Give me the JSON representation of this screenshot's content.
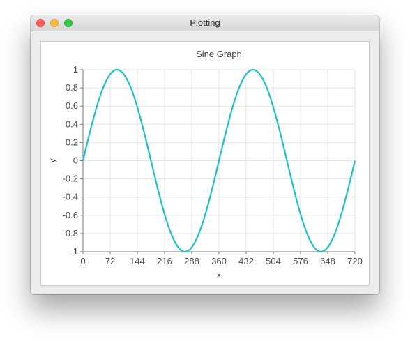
{
  "window": {
    "title": "Plotting"
  },
  "chart_data": {
    "type": "line",
    "title": "Sine Graph",
    "xlabel": "x",
    "ylabel": "y",
    "xlim": [
      0,
      720
    ],
    "ylim": [
      -1,
      1
    ],
    "xticks": [
      0,
      72,
      144,
      216,
      288,
      360,
      432,
      504,
      576,
      648,
      720
    ],
    "xtick_labels": [
      "0",
      "72",
      "144",
      "216",
      "288",
      "360",
      "432",
      "504",
      "576",
      "648",
      "720"
    ],
    "yticks": [
      1,
      0.8,
      0.6,
      0.4,
      0.2,
      0,
      -0.2,
      -0.4,
      -0.6,
      -0.8,
      -1
    ],
    "ytick_labels": [
      "1",
      "0.8",
      "0.6",
      "0.4",
      "0.2",
      "0",
      "-0.2",
      "-0.4",
      "-0.6",
      "-0.8",
      "-1"
    ],
    "grid": true,
    "series": [
      {
        "color": "#1fc2c2",
        "x": [
          0,
          18,
          36,
          54,
          72,
          90,
          108,
          126,
          144,
          162,
          180,
          198,
          216,
          234,
          252,
          270,
          288,
          306,
          324,
          342,
          360,
          378,
          396,
          414,
          432,
          450,
          468,
          486,
          504,
          522,
          540,
          558,
          576,
          594,
          612,
          630,
          648,
          666,
          684,
          702,
          720
        ],
        "y": [
          0,
          0.309,
          0.588,
          0.809,
          0.951,
          1,
          0.951,
          0.809,
          0.588,
          0.309,
          0,
          -0.309,
          -0.588,
          -0.809,
          -0.951,
          -1,
          -0.951,
          -0.809,
          -0.588,
          -0.309,
          0,
          0.309,
          0.588,
          0.809,
          0.951,
          1,
          0.951,
          0.809,
          0.588,
          0.309,
          0,
          -0.309,
          -0.588,
          -0.809,
          -0.951,
          -1,
          -0.951,
          -0.809,
          -0.588,
          -0.309,
          0
        ]
      }
    ]
  }
}
